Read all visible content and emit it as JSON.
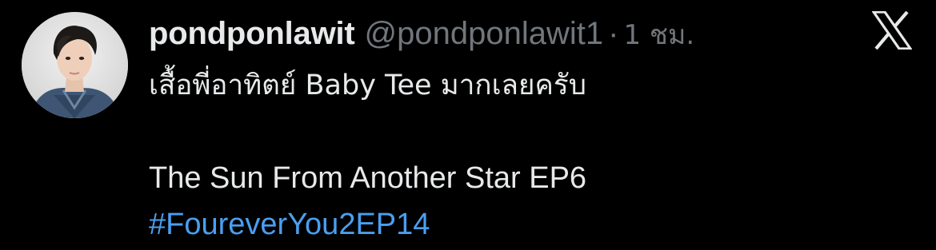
{
  "tweet": {
    "author": {
      "display_name": "pondponlawit",
      "handle": "@pondponlawit1",
      "avatar_icon": "profile-photo"
    },
    "separator": "·",
    "time": "1 ชม.",
    "platform_icon": "x-logo-icon",
    "text_lines": [
      "เสื้อพี่อาทิตย์ Baby Tee มากเลยครับ",
      "",
      "The Sun From Another Star EP6"
    ],
    "hashtag": "#FoureverYou2EP14"
  },
  "colors": {
    "background": "#000000",
    "primary_text": "#e7e9ea",
    "secondary_text": "#71767b",
    "link": "#4a9ff0"
  }
}
